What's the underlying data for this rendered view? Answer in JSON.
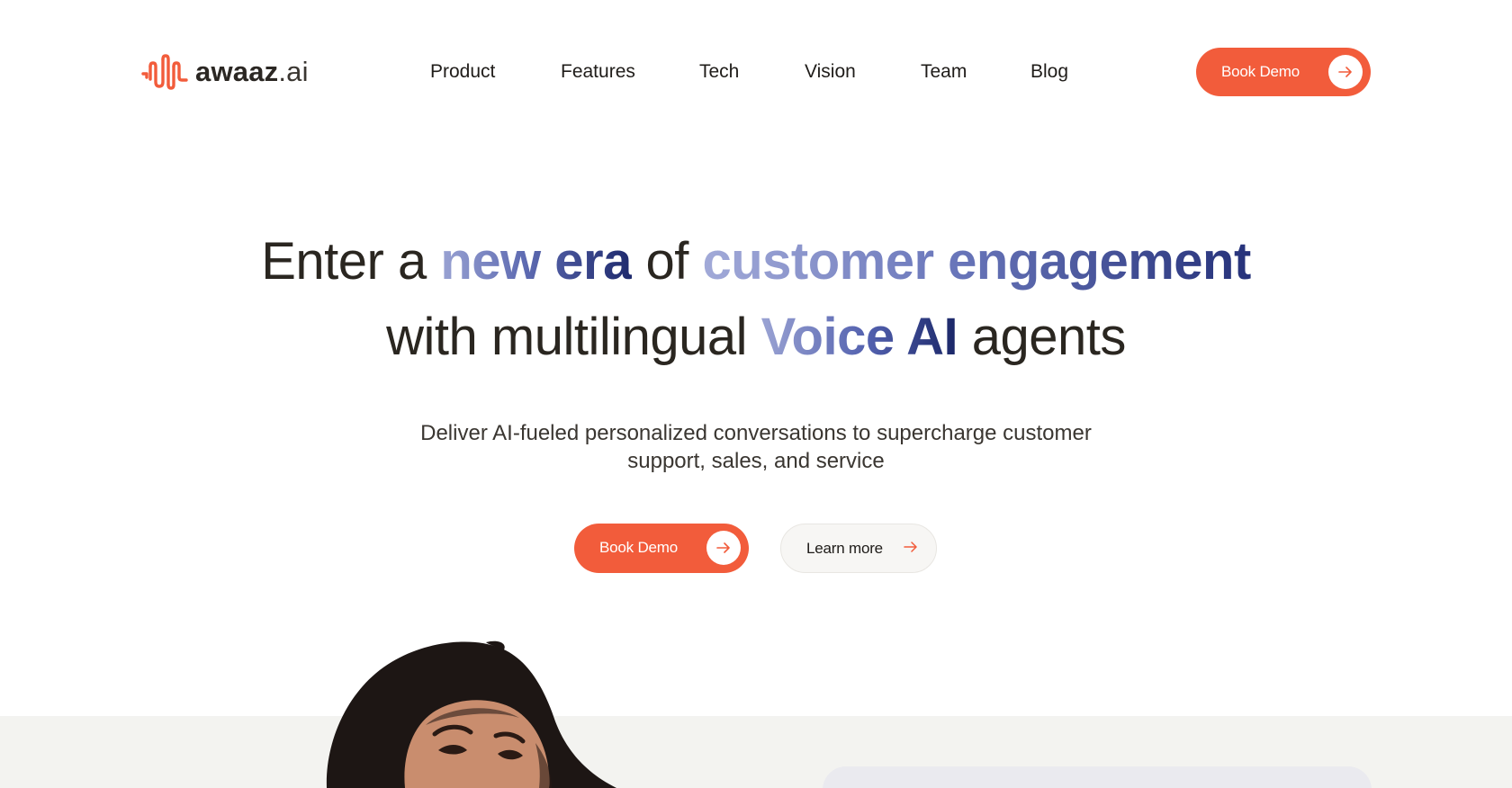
{
  "brand": {
    "name": "awaaz",
    "suffix": ".ai",
    "accent_color": "#f25c3b",
    "logo_icon": "soundwave-logo-icon"
  },
  "nav": {
    "items": [
      {
        "label": "Product"
      },
      {
        "label": "Features"
      },
      {
        "label": "Tech"
      },
      {
        "label": "Vision"
      },
      {
        "label": "Team"
      },
      {
        "label": "Blog"
      }
    ]
  },
  "header_cta": {
    "label": "Book Demo",
    "icon": "arrow-right-icon"
  },
  "hero": {
    "line1": {
      "w1": "Enter a",
      "w2": "new era",
      "w3": "of",
      "w4": "customer engagement"
    },
    "line2": {
      "w1": "with multilingual",
      "w2": "Voice AI",
      "w3": "agents"
    },
    "subtitle_line1": "Deliver AI-fueled personalized conversations to supercharge customer",
    "subtitle_line2": "support, sales, and service",
    "primary_cta": "Book Demo",
    "secondary_cta": "Learn more",
    "gradient_colors": [
      "#9aa3d3",
      "#5d6ab1",
      "#1e2a6d"
    ]
  },
  "colors": {
    "lower_band": "#f3f3f0",
    "text_dark": "#2a2620"
  }
}
